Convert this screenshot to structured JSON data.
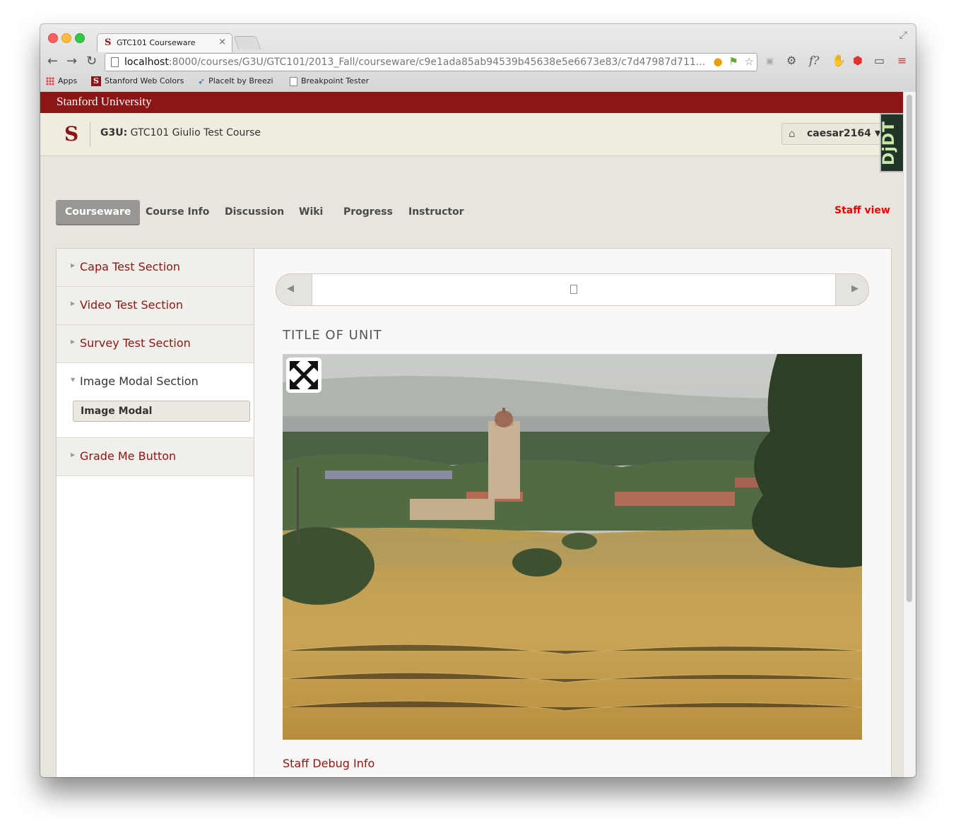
{
  "browser": {
    "tab_title": "GTC101 Courseware",
    "tab_close": "×",
    "url_host": "localhost",
    "url_rest": ":8000/courses/G3U/GTC101/2013_Fall/courseware/c9e1ada85ab94539b45638e5e6673e83/c7d47987d711...",
    "bookmarks": [
      {
        "label": "Apps",
        "icon": "apps-grid-icon"
      },
      {
        "label": "Stanford Web Colors",
        "icon": "stanford-s-icon"
      },
      {
        "label": "PlaceIt by Breezi",
        "icon": "bird-icon"
      },
      {
        "label": "Breakpoint Tester",
        "icon": "document-icon"
      }
    ]
  },
  "site": {
    "university": "Stanford University",
    "logo_letter": "S",
    "course_code": "G3U:",
    "course_name": "GTC101 Giulio Test Course",
    "username": "caesar2164",
    "djdt_label": "DjDT"
  },
  "nav": {
    "tabs": [
      {
        "label": "Courseware",
        "active": true
      },
      {
        "label": "Course Info",
        "active": false
      },
      {
        "label": "Discussion",
        "active": false
      },
      {
        "label": "Wiki",
        "active": false
      },
      {
        "label": "Progress",
        "active": false
      },
      {
        "label": "Instructor",
        "active": false
      }
    ],
    "staff_view": "Staff view"
  },
  "sidebar": {
    "chapters": [
      {
        "label": "Capa Test Section",
        "open": false
      },
      {
        "label": "Video Test Section",
        "open": false
      },
      {
        "label": "Survey Test Section",
        "open": false
      },
      {
        "label": "Image Modal Section",
        "open": true,
        "sections": [
          {
            "label": "Image Modal"
          }
        ]
      },
      {
        "label": "Grade Me Button",
        "open": false
      }
    ]
  },
  "main": {
    "unit_title": "TITLE OF UNIT",
    "staff_debug": "Staff Debug Info"
  },
  "colors": {
    "stanford_red": "#8c1515",
    "staff_view_red": "#ee0000",
    "active_tab": "#999793"
  }
}
